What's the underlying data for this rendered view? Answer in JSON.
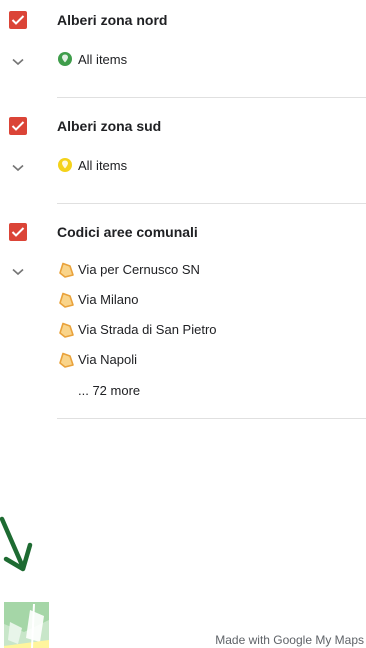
{
  "layers": [
    {
      "title": "Alberi zona nord",
      "items": [
        {
          "label": "All items",
          "icon": "green-pin-icon"
        }
      ]
    },
    {
      "title": "Alberi zona sud",
      "items": [
        {
          "label": "All items",
          "icon": "yellow-pin-icon"
        }
      ]
    },
    {
      "title": "Codici aree comunali",
      "items": [
        {
          "label": "Via per Cernusco SN",
          "icon": "polygon-icon"
        },
        {
          "label": "Via Milano",
          "icon": "polygon-icon"
        },
        {
          "label": "Via Strada di San Pietro",
          "icon": "polygon-icon"
        },
        {
          "label": "Via Napoli",
          "icon": "polygon-icon"
        }
      ],
      "more": "... 72 more"
    }
  ],
  "footer": {
    "made_with": "Made with Google My Maps"
  },
  "colors": {
    "checkbox": "#db4437",
    "green_pin": "#3f9d4b",
    "yellow_pin": "#f4d21a",
    "polygon": "#f4b24f",
    "arrow": "#1e6b32"
  }
}
